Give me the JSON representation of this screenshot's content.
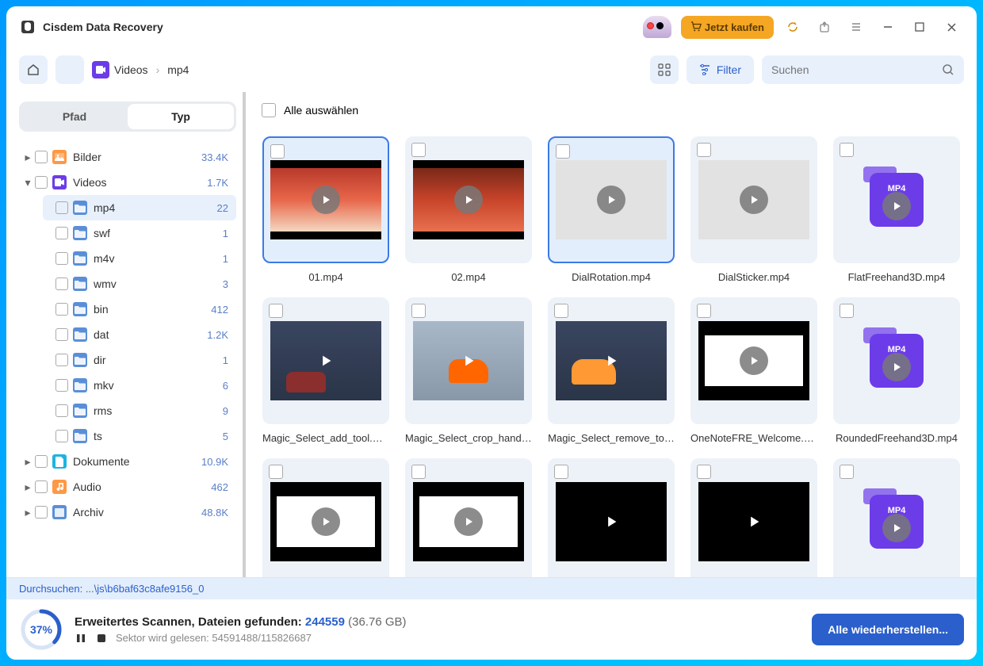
{
  "app": {
    "title": "Cisdem Data Recovery"
  },
  "buy": {
    "label": "Jetzt kaufen"
  },
  "breadcrumb": {
    "videos": "Videos",
    "mp4": "mp4"
  },
  "toolbar": {
    "filter": "Filter",
    "searchPlaceholder": "Suchen"
  },
  "tabs": {
    "path": "Pfad",
    "type": "Typ"
  },
  "tree": {
    "bilder": {
      "label": "Bilder",
      "count": "33.4K"
    },
    "videos": {
      "label": "Videos",
      "count": "1.7K"
    },
    "mp4": {
      "label": "mp4",
      "count": "22"
    },
    "swf": {
      "label": "swf",
      "count": "1"
    },
    "m4v": {
      "label": "m4v",
      "count": "1"
    },
    "wmv": {
      "label": "wmv",
      "count": "3"
    },
    "bin": {
      "label": "bin",
      "count": "412"
    },
    "dat": {
      "label": "dat",
      "count": "1.2K"
    },
    "dir": {
      "label": "dir",
      "count": "1"
    },
    "mkv": {
      "label": "mkv",
      "count": "6"
    },
    "rms": {
      "label": "rms",
      "count": "9"
    },
    "ts": {
      "label": "ts",
      "count": "5"
    },
    "dokumente": {
      "label": "Dokumente",
      "count": "10.9K"
    },
    "audio": {
      "label": "Audio",
      "count": "462"
    },
    "archiv": {
      "label": "Archiv",
      "count": "48.8K"
    }
  },
  "content": {
    "selectAll": "Alle auswählen"
  },
  "files": {
    "f0": "01.mp4",
    "f1": "02.mp4",
    "f2": "DialRotation.mp4",
    "f3": "DialSticker.mp4",
    "f4": "FlatFreehand3D.mp4",
    "f5": "Magic_Select_add_tool.m…",
    "f6": "Magic_Select_crop_handl…",
    "f7": "Magic_Select_remove_to…",
    "f8": "OneNoteFRE_Welcome.m…",
    "f9": "RoundedFreehand3D.mp4"
  },
  "mp4icon": {
    "label": "MP4"
  },
  "scan": {
    "path": "Durchsuchen: ...\\js\\b6baf63c8afe9156_0",
    "pct": "37%",
    "line1a": "Erweitertes Scannen, Dateien gefunden: ",
    "found": "244559",
    "size": " (36.76 GB)",
    "sector": "Sektor wird gelesen: 54591488/115826687",
    "recover": "Alle wiederherstellen..."
  }
}
